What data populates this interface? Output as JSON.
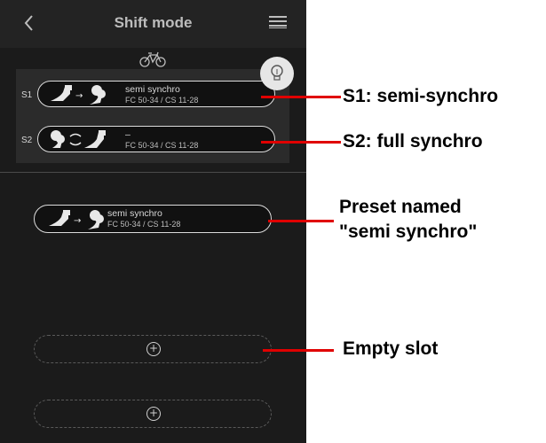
{
  "header": {
    "title": "Shift mode",
    "back_icon": "chevron-left-icon",
    "menu_icon": "hamburger-menu-icon"
  },
  "bike_icon": "bicycle-icon",
  "tip_icon": "lightbulb-icon",
  "slots": [
    {
      "label": "S1",
      "name": "semi synchro",
      "spec": "FC 50-34 / CS 11-28",
      "mode_icon": "semi-synchro-shift-icon"
    },
    {
      "label": "S2",
      "name": "–",
      "spec": "FC 50-34 / CS 11-28",
      "mode_icon": "full-synchro-shift-icon"
    }
  ],
  "preset": {
    "name": "semi synchro",
    "spec": "FC 50-34 / CS 11-28",
    "mode_icon": "semi-synchro-shift-icon"
  },
  "empty_slots": [
    {
      "icon": "plus-icon"
    },
    {
      "icon": "plus-icon"
    }
  ],
  "annotations": {
    "s1": "S1: semi-synchro",
    "s2": "S2: full synchro",
    "preset_line1": "Preset named",
    "preset_line2": "\"semi synchro\"",
    "empty": "Empty slot"
  },
  "colors": {
    "background": "#1b1b1b",
    "header": "#232323",
    "arrow": "#e00000",
    "text": "#d8d8d8"
  }
}
